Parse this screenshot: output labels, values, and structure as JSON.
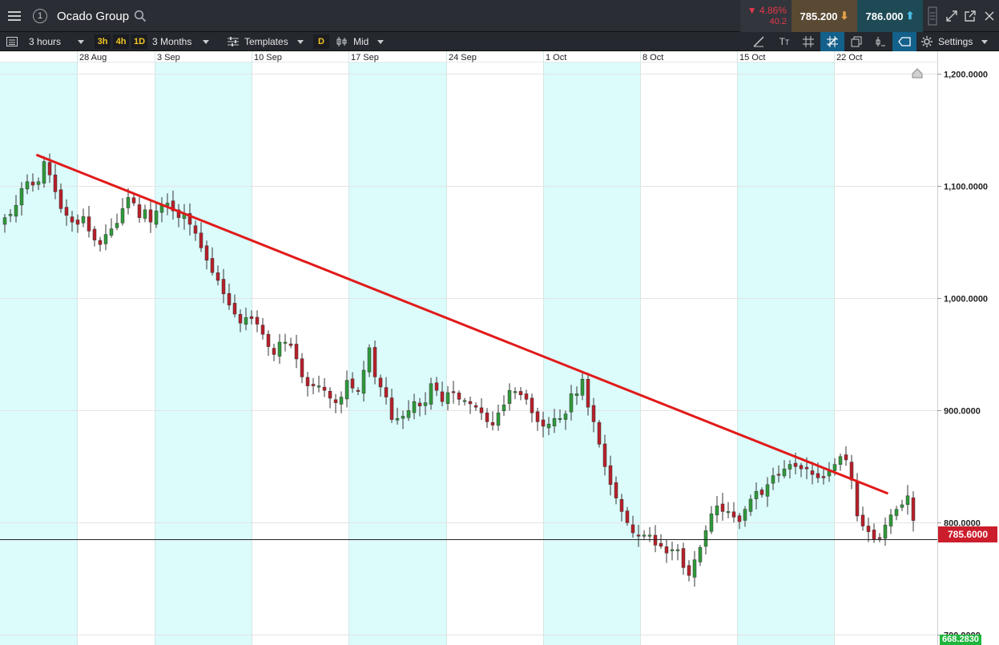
{
  "header": {
    "instrument": "Ocado Group",
    "link_number": "1",
    "change_pct": "▼ 4.86%",
    "change_abs": "40.2",
    "sell_price": "785.200",
    "buy_price": "786.000"
  },
  "toolbar": {
    "interval": "3 hours",
    "quick_intervals": [
      "3h",
      "4h",
      "1D"
    ],
    "range": "3 Months",
    "templates": "Templates",
    "d_button": "D",
    "price_type": "Mid",
    "settings": "Settings"
  },
  "colors": {
    "up_candle": "#2f9a3a",
    "down_candle": "#b8202a",
    "trendline": "#e11a1a",
    "weekend_band": "#dcfbfb",
    "last_price_label": "#cc1d2c",
    "low_label": "#1fb53c"
  },
  "chart_data": {
    "type": "candlestick",
    "instrument": "Ocado Group",
    "x_tick_labels": [
      "28 Aug",
      "3 Sep",
      "10 Sep",
      "17 Sep",
      "24 Sep",
      "1 Oct",
      "8 Oct",
      "15 Oct",
      "22 Oct"
    ],
    "y_tick_labels": [
      "1,200.0000",
      "1,100.0000",
      "1,000.0000",
      "900.0000",
      "800.0000",
      "700.0000"
    ],
    "y_ticks": [
      1200,
      1100,
      1000,
      900,
      800,
      700
    ],
    "ylim": [
      691,
      1211
    ],
    "last_price": 785.6,
    "last_price_label": "785.6000",
    "low_label": "668.2830",
    "trendline": [
      {
        "date": "2018-08-24",
        "price": 1128
      },
      {
        "date": "2018-10-26",
        "price": 826
      }
    ],
    "approximate_closes": [
      1072,
      1075,
      1083,
      1098,
      1104,
      1101,
      1104,
      1122,
      1110,
      1095,
      1080,
      1074,
      1068,
      1066,
      1073,
      1060,
      1052,
      1048,
      1057,
      1062,
      1067,
      1080,
      1090,
      1085,
      1072,
      1079,
      1068,
      1078,
      1083,
      1085,
      1078,
      1072,
      1076,
      1066,
      1058,
      1045,
      1034,
      1023,
      1016,
      1004,
      994,
      986,
      978,
      983,
      982,
      977,
      968,
      957,
      950,
      961,
      961,
      958,
      946,
      930,
      922,
      922,
      922,
      918,
      911,
      907,
      912,
      927,
      920,
      917,
      936,
      956,
      930,
      921,
      912,
      892,
      893,
      895,
      900,
      908,
      904,
      907,
      924,
      918,
      908,
      916,
      916,
      910,
      909,
      906,
      903,
      898,
      890,
      887,
      898,
      905,
      918,
      917,
      914,
      910,
      898,
      890,
      886,
      888,
      893,
      893,
      897,
      915,
      915,
      928,
      903,
      890,
      870,
      850,
      834,
      822,
      810,
      800,
      791,
      788,
      789,
      789,
      780,
      779,
      773,
      776,
      776,
      760,
      753,
      767,
      778,
      793,
      808,
      815,
      810,
      810,
      805,
      801,
      812,
      821,
      828,
      825,
      834,
      842,
      843,
      848,
      852,
      850,
      848,
      848,
      843,
      840,
      840,
      846,
      852,
      859,
      856,
      838,
      806,
      797,
      792,
      785,
      786,
      798,
      807,
      812,
      816,
      824,
      802
    ]
  }
}
